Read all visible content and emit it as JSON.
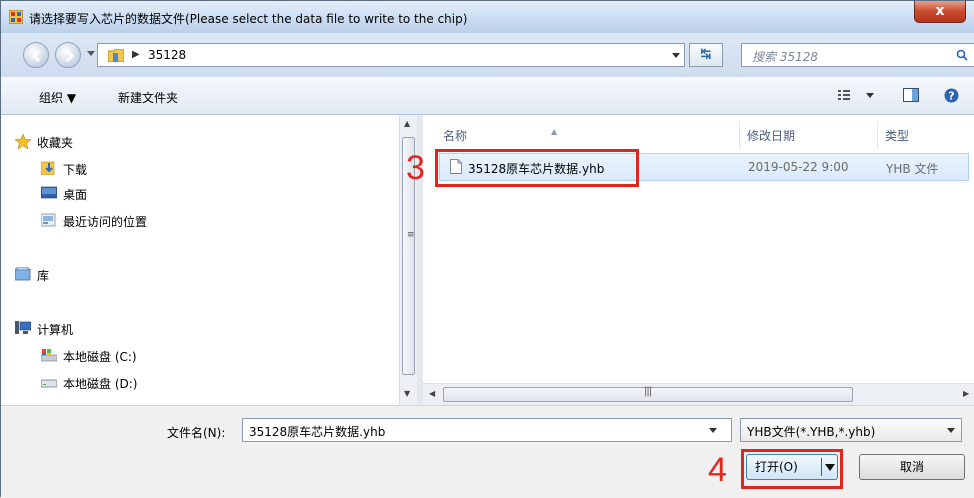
{
  "window": {
    "title": "请选择要写入芯片的数据文件(Please select the data file to write to the chip)",
    "close_label": "x"
  },
  "address_bar": {
    "path": "35128",
    "search_placeholder": "搜索 35128"
  },
  "toolbar": {
    "organize_label": "组织 ▼",
    "new_folder_label": "新建文件夹"
  },
  "nav_pane": {
    "favorites": "收藏夹",
    "downloads": "下载",
    "desktop": "桌面",
    "recent": "最近访问的位置",
    "libraries": "库",
    "computer": "计算机",
    "disk_c": "本地磁盘 (C:)",
    "disk_d": "本地磁盘 (D:)"
  },
  "file_list": {
    "columns": {
      "name": "名称",
      "modified": "修改日期",
      "type": "类型"
    },
    "rows": [
      {
        "name": "35128原车芯片数据.yhb",
        "modified": "2019-05-22 9:00",
        "type": "YHB 文件"
      }
    ]
  },
  "bottom": {
    "filename_label": "文件名(N):",
    "filename_value": "35128原车芯片数据.yhb",
    "filter_value": "YHB文件(*.YHB,*.yhb)",
    "open_label": "打开(O)",
    "cancel_label": "取消"
  },
  "annotations": {
    "step3": "3",
    "step4": "4"
  },
  "colors": {
    "annotation": "#e3261d",
    "selection": "#d9eafb",
    "accent": "#2a64b5"
  }
}
